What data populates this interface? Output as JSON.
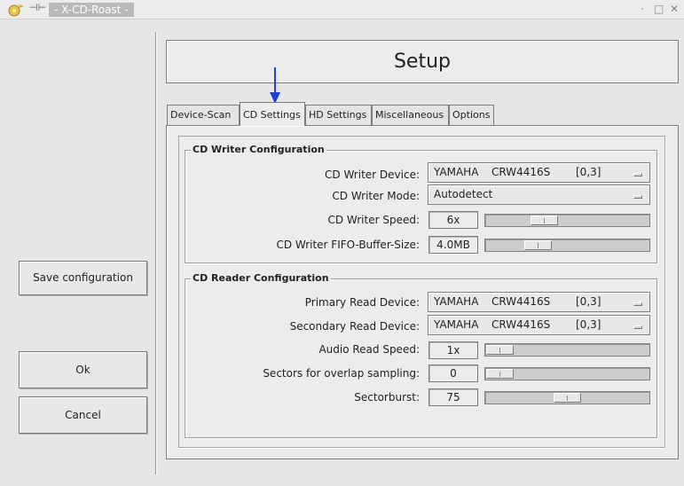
{
  "window": {
    "title": "- X-CD-Roast -",
    "controls": {
      "minimize": "·",
      "maximize": "□",
      "close": "✕"
    }
  },
  "sidebar": {
    "save": "Save configuration",
    "ok": "Ok",
    "cancel": "Cancel"
  },
  "header": {
    "title": "Setup"
  },
  "tabs": [
    {
      "label": "Device-Scan",
      "active": false
    },
    {
      "label": "CD Settings",
      "active": true
    },
    {
      "label": "HD Settings",
      "active": false
    },
    {
      "label": "Miscellaneous",
      "active": false
    },
    {
      "label": "Options",
      "active": false
    }
  ],
  "writer": {
    "title": "CD Writer Configuration",
    "device_label": "CD Writer Device:",
    "device": {
      "vendor": "YAMAHA",
      "model": "CRW4416S",
      "id": "[0,3]"
    },
    "mode_label": "CD Writer Mode:",
    "mode": "Autodetect",
    "speed_label": "CD Writer Speed:",
    "speed": {
      "value": "6x",
      "level": 0.33
    },
    "fifo_label": "CD Writer FIFO-Buffer-Size:",
    "fifo": {
      "value": "4.0MB",
      "level": 0.28
    }
  },
  "reader": {
    "title": "CD Reader Configuration",
    "primary_label": "Primary Read Device:",
    "primary": {
      "vendor": "YAMAHA",
      "model": "CRW4416S",
      "id": "[0,3]"
    },
    "secondary_label": "Secondary Read Device:",
    "secondary": {
      "vendor": "YAMAHA",
      "model": "CRW4416S",
      "id": "[0,3]"
    },
    "audio_speed_label": "Audio Read Speed:",
    "audio_speed": {
      "value": "1x",
      "level": 0.0
    },
    "overlap_label": "Sectors for overlap sampling:",
    "overlap": {
      "value": "0",
      "level": 0.0
    },
    "sectorburst_label": "Sectorburst:",
    "sectorburst": {
      "value": "75",
      "level": 0.5
    }
  },
  "colors": {
    "arrow": "#1f3fd6",
    "background": "#ececec"
  },
  "icons": [
    "app-icon",
    "pin-icon",
    "arrow-down-icon",
    "dropdown-indicator-icon"
  ]
}
